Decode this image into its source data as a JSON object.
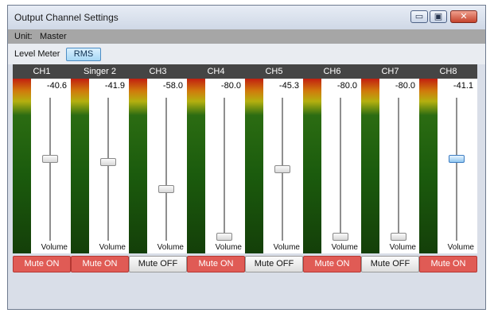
{
  "window": {
    "title": "Output Channel Settings"
  },
  "titlebar_buttons": {
    "minimize": "▭",
    "maximize": "▣",
    "close": "✕"
  },
  "unit": {
    "label": "Unit:",
    "value": "Master"
  },
  "toolbar": {
    "level_meter_label": "Level Meter",
    "mode_button": "RMS"
  },
  "channels": [
    {
      "name": "CH1",
      "value": "-40.6",
      "volume_label": "Volume",
      "mute": "Mute ON",
      "fader_level": 0.57,
      "selected": false
    },
    {
      "name": "Singer 2",
      "value": "-41.9",
      "volume_label": "Volume",
      "mute": "Mute ON",
      "fader_level": 0.55,
      "selected": false
    },
    {
      "name": "CH3",
      "value": "-58.0",
      "volume_label": "Volume",
      "mute": "Mute OFF",
      "fader_level": 0.36,
      "selected": false
    },
    {
      "name": "CH4",
      "value": "-80.0",
      "volume_label": "Volume",
      "mute": "Mute ON",
      "fader_level": 0.03,
      "selected": false
    },
    {
      "name": "CH5",
      "value": "-45.3",
      "volume_label": "Volume",
      "mute": "Mute OFF",
      "fader_level": 0.5,
      "selected": false
    },
    {
      "name": "CH6",
      "value": "-80.0",
      "volume_label": "Volume",
      "mute": "Mute ON",
      "fader_level": 0.03,
      "selected": false
    },
    {
      "name": "CH7",
      "value": "-80.0",
      "volume_label": "Volume",
      "mute": "Mute OFF",
      "fader_level": 0.03,
      "selected": false
    },
    {
      "name": "CH8",
      "value": "-41.1",
      "volume_label": "Volume",
      "mute": "Mute ON",
      "fader_level": 0.57,
      "selected": true
    }
  ],
  "colors": {
    "mute_on": "#e05b55",
    "header": "#454545",
    "selected_thumb": "#8fc6f0"
  }
}
